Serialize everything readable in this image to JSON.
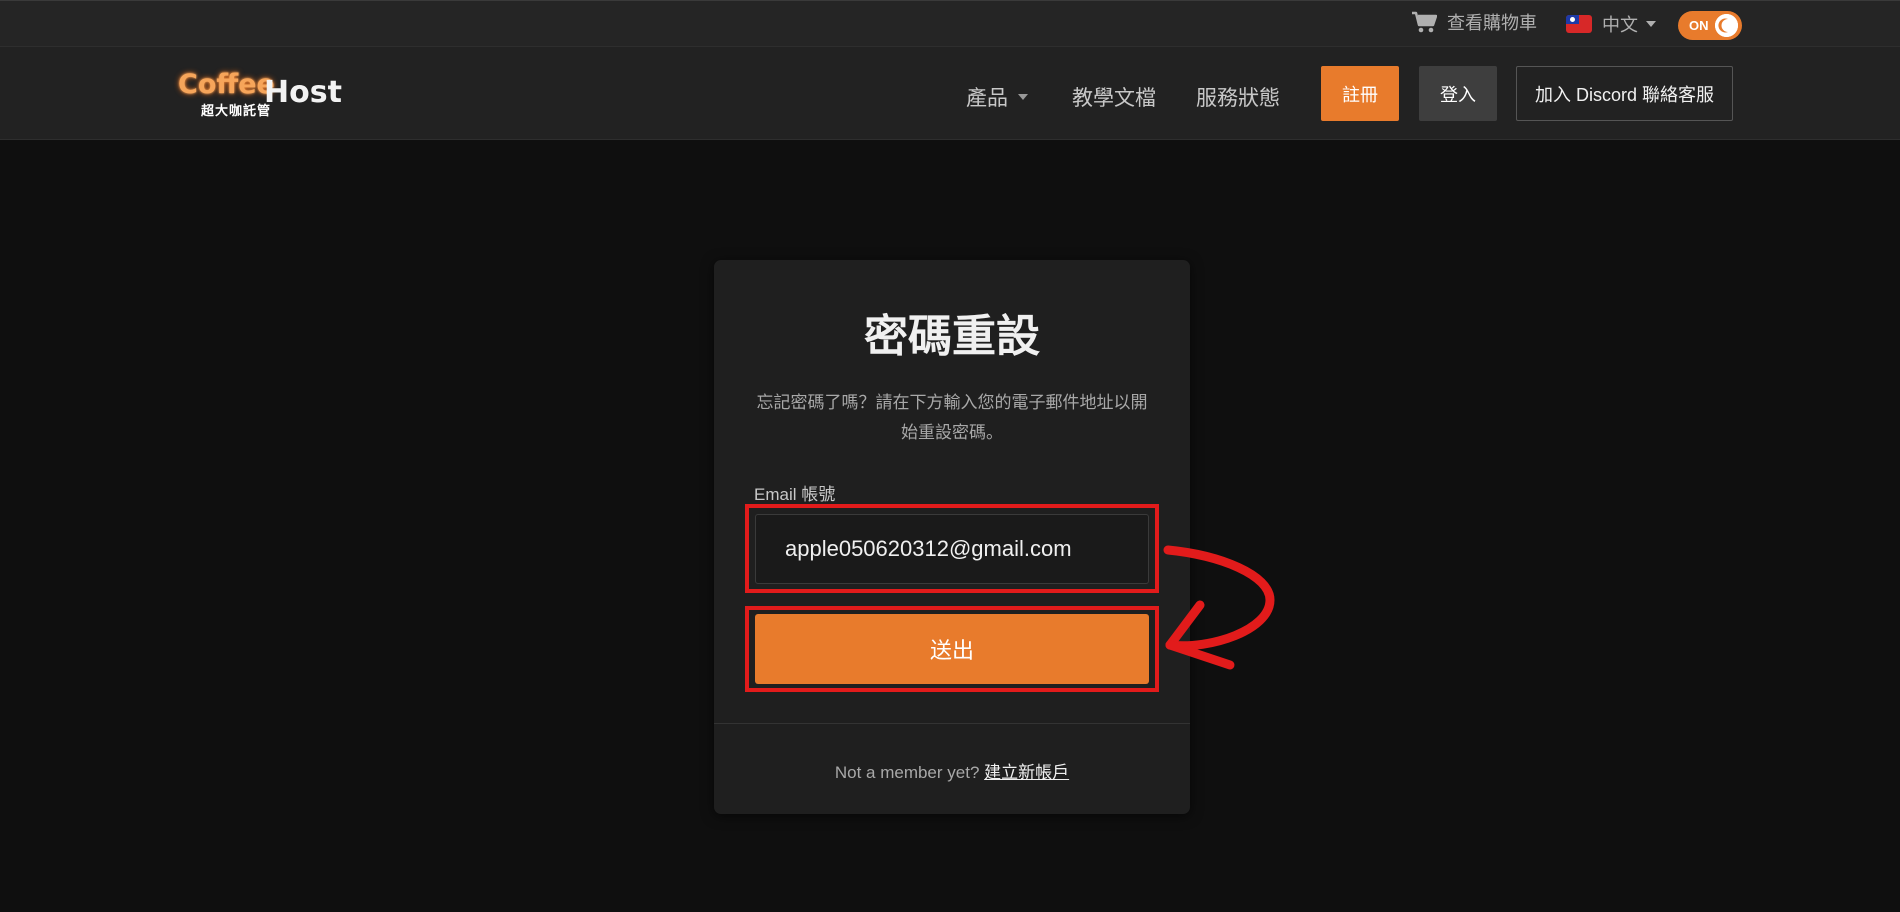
{
  "topbar": {
    "cart_label": "查看購物車",
    "language_label": "中文",
    "theme_toggle_label": "ON"
  },
  "brand": {
    "logo_main": "Coffee",
    "logo_sub": "超大咖託管",
    "logo_suffix": "Host"
  },
  "nav": {
    "products": "產品",
    "docs": "教學文檔",
    "status": "服務狀態",
    "register": "註冊",
    "login": "登入",
    "discord": "加入 Discord 聯絡客服"
  },
  "reset_form": {
    "title": "密碼重設",
    "description": "忘記密碼了嗎？請在下方輸入您的電子郵件地址以開始重設密碼。",
    "email_label": "Email 帳號",
    "email_value": "apple050620312@gmail.com",
    "submit_label": "送出",
    "footer_text": "Not a member yet?",
    "footer_link": "建立新帳戶"
  },
  "colors": {
    "accent": "#e87b2c",
    "annotation": "#e21b1b",
    "background": "#0f0f0f",
    "card": "#1f1f1f"
  },
  "icons": {
    "cart": "cart-icon",
    "flag": "taiwan-flag-icon",
    "moon": "moon-icon",
    "caret": "chevron-down-icon",
    "arrow": "annotation-arrow"
  }
}
